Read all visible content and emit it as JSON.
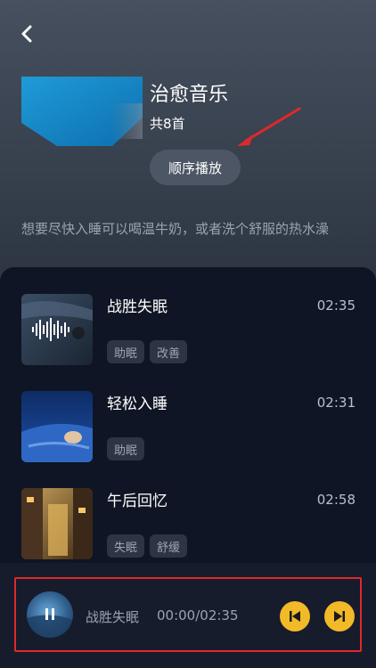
{
  "header": {
    "back_icon": "chevron-left-icon"
  },
  "album": {
    "title": "治愈音乐",
    "count": "共8首",
    "play_order_label": "顺序播放",
    "description": "想要尽快入睡可以喝温牛奶，或者洗个舒服的热水澡",
    "cover_color": "#1a8fd1"
  },
  "tracks": [
    {
      "title": "战胜失眠",
      "duration": "02:35",
      "tags": [
        "助眠",
        "改善"
      ]
    },
    {
      "title": "轻松入睡",
      "duration": "02:31",
      "tags": [
        "助眠"
      ]
    },
    {
      "title": "午后回忆",
      "duration": "02:58",
      "tags": [
        "失眠",
        "舒缓"
      ]
    }
  ],
  "player": {
    "title": "战胜失眠",
    "time": "00:00/02:35",
    "prev_icon": "skip-previous-icon",
    "next_icon": "skip-next-icon",
    "accent": "#f2b928"
  },
  "annotations": {
    "frame_color": "#e0282c"
  }
}
